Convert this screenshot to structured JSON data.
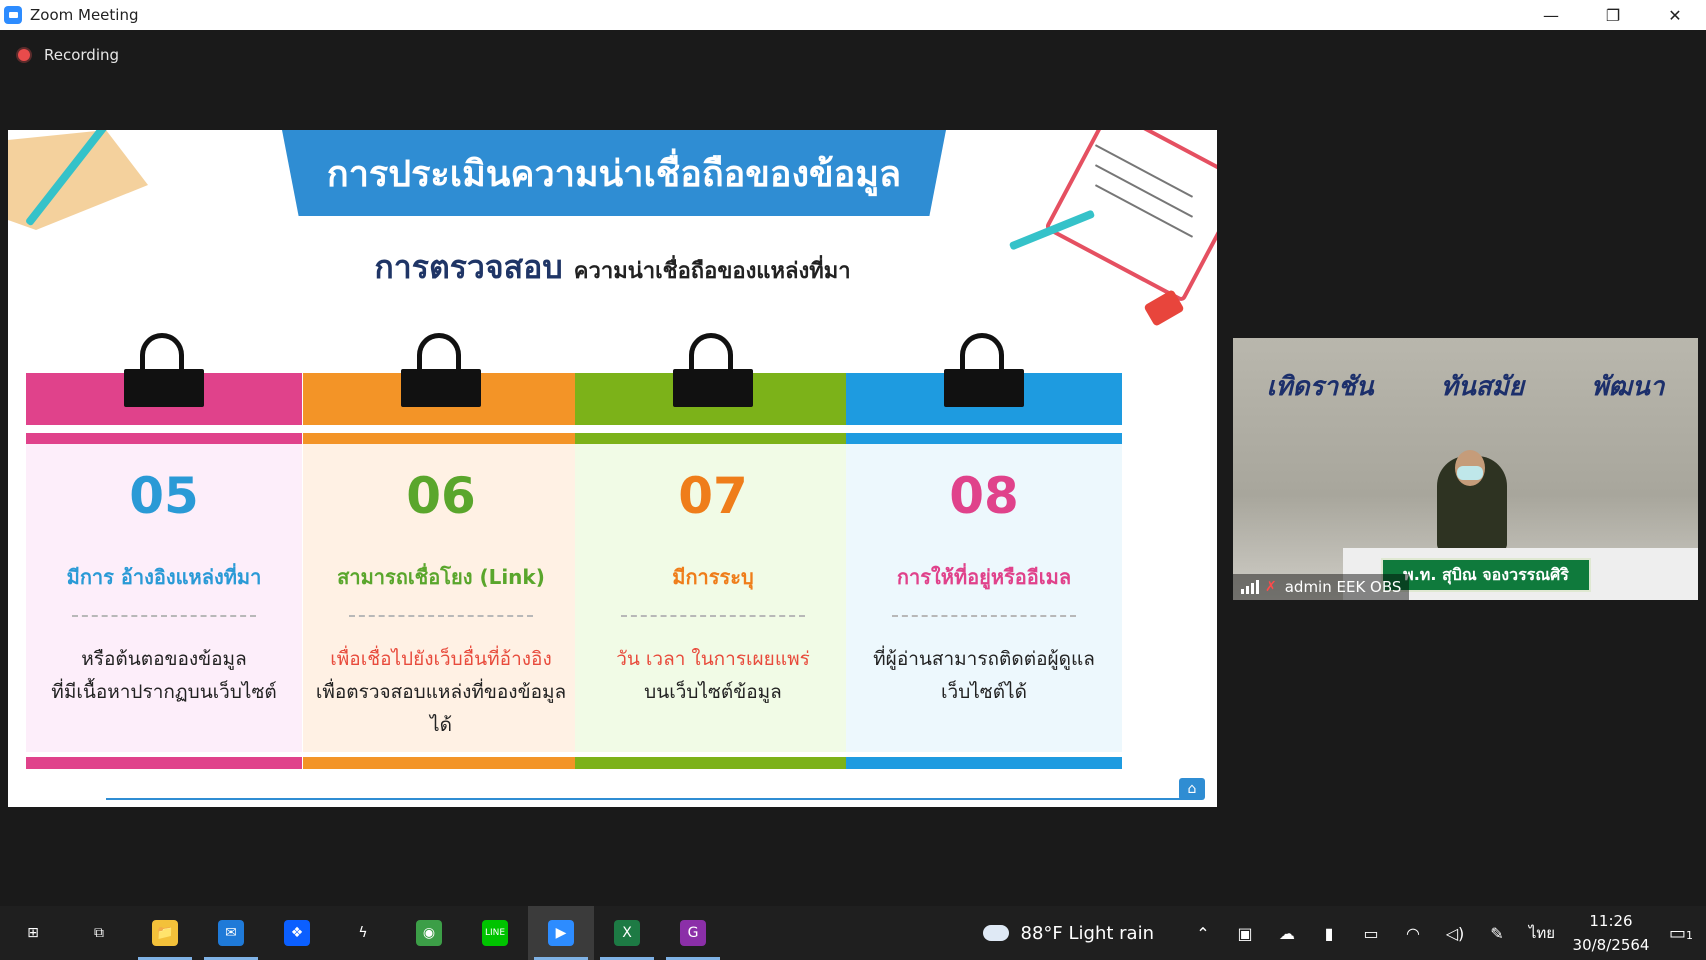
{
  "window": {
    "title": "Zoom Meeting",
    "controls": {
      "minimize": "—",
      "restore": "❐",
      "close": "✕"
    }
  },
  "recording": {
    "label": "Recording"
  },
  "slide": {
    "title": "การประเมินความน่าเชื่อถือของข้อมูล",
    "subtitle_main": "การตรวจสอบ",
    "subtitle_rest": "ความน่าเชื่อถือของแหล่งที่มา",
    "cards": [
      {
        "number": "05",
        "label": "มีการ อ้างอิงแหล่งที่มา",
        "desc_lines": [
          "หรือต้นตอของข้อมูล",
          "ที่มีเนื้อหาปรากฏบนเว็บไซต์"
        ],
        "desc_highlight": "",
        "accent": "#e0428b",
        "num_color": "#2a9ad6",
        "label_color": "#2a9ad6",
        "panel": "#fdeefa"
      },
      {
        "number": "06",
        "label": "สามารถเชื่อโยง (Link)",
        "desc_highlight": "เพื่อเชื่อไปยังเว็บอื่นที่อ้างอิง",
        "desc_lines": [
          "เพื่อตรวจสอบแหล่งที่ของข้อมูล",
          "ได้"
        ],
        "accent": "#f39427",
        "num_color": "#5aa62c",
        "label_color": "#5aa62c",
        "panel": "#fff1e4"
      },
      {
        "number": "07",
        "label": "มีการระบุ",
        "desc_highlight": "วัน เวลา ในการเผยแพร่",
        "desc_lines": [
          "บนเว็บไซต์ข้อมูล"
        ],
        "accent": "#7cb219",
        "num_color": "#ef7d1a",
        "label_color": "#ef7d1a",
        "panel": "#f1fbe6"
      },
      {
        "number": "08",
        "label": "การให้ที่อยู่หรืออีเมล",
        "desc_highlight": "",
        "desc_lines": [
          "ที่ผู้อ่านสามารถติดต่อผู้ดูแล",
          "เว็บไซต์ได้"
        ],
        "accent": "#1e9be0",
        "num_color": "#e0428b",
        "label_color": "#e0428b",
        "panel": "#edf8fd"
      }
    ],
    "highlight_color": "#e84b3c"
  },
  "video": {
    "wall_words": [
      "เทิดราชัน",
      "ทันสมัย",
      "พัฒนา"
    ],
    "nameplate": "พ.ท. สุบิณ จองวรรณศิริ",
    "participant": "admin EEK OBS"
  },
  "taskbar": {
    "apps": [
      {
        "name": "start",
        "glyph": "⊞"
      },
      {
        "name": "task-view",
        "glyph": "⧉"
      },
      {
        "name": "file-explorer",
        "glyph": "📁"
      },
      {
        "name": "mail",
        "glyph": "✉"
      },
      {
        "name": "dropbox",
        "glyph": "❖"
      },
      {
        "name": "app-s",
        "glyph": "ϟ"
      },
      {
        "name": "chrome",
        "glyph": "◉"
      },
      {
        "name": "line",
        "glyph": "LINE"
      },
      {
        "name": "zoom",
        "glyph": "▶"
      },
      {
        "name": "excel",
        "glyph": "X"
      },
      {
        "name": "pdf",
        "glyph": "G"
      }
    ],
    "weather": "88°F  Light rain",
    "language": "ไทย",
    "time": "11:26",
    "date": "30/8/2564",
    "notifications": "1"
  }
}
